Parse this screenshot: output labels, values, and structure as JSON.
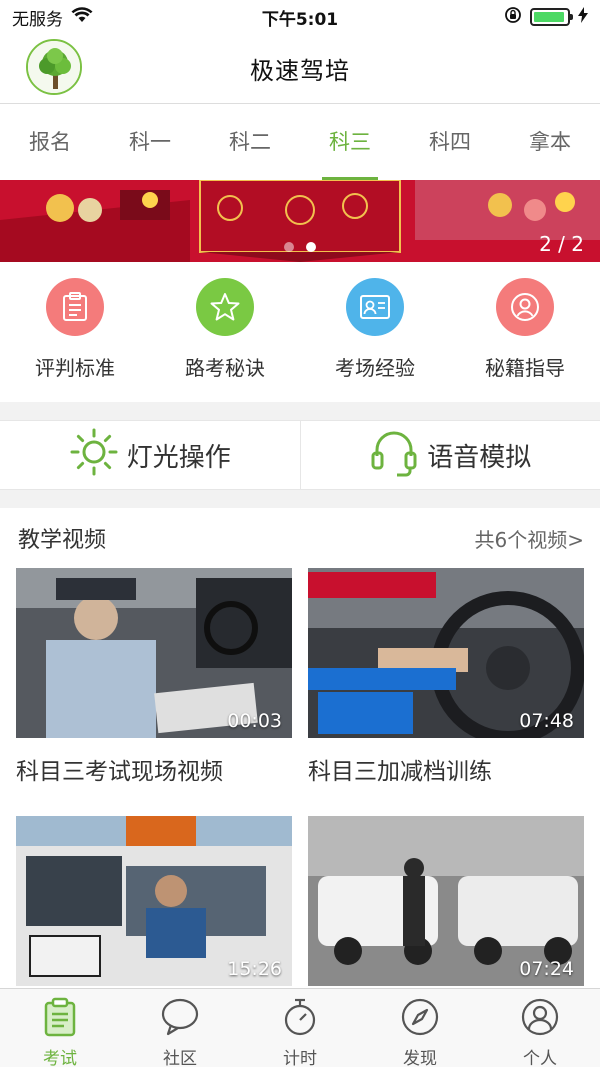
{
  "status_bar": {
    "carrier": "无服务",
    "time": "下午5:01",
    "battery_level": 0.95
  },
  "header": {
    "title": "极速驾培"
  },
  "tabs": [
    {
      "label": "报名",
      "active": false
    },
    {
      "label": "科一",
      "active": false
    },
    {
      "label": "科二",
      "active": false
    },
    {
      "label": "科三",
      "active": true
    },
    {
      "label": "科四",
      "active": false
    },
    {
      "label": "拿本",
      "active": false
    }
  ],
  "banner": {
    "counter": "2 / 2",
    "active_dot": 2,
    "dot_count": 2
  },
  "quick_actions": [
    {
      "label": "评判标准",
      "color": "#f47b7b",
      "icon": "clipboard-icon"
    },
    {
      "label": "路考秘诀",
      "color": "#7ac943",
      "icon": "star-icon"
    },
    {
      "label": "考场经验",
      "color": "#4fb4ea",
      "icon": "id-card-icon"
    },
    {
      "label": "秘籍指导",
      "color": "#f47b7b",
      "icon": "user-icon"
    }
  ],
  "features": {
    "light_label": "灯光操作",
    "voice_label": "语音模拟"
  },
  "videos": {
    "section_title": "教学视频",
    "more_label": "共6个视频>",
    "items": [
      {
        "title": "科目三考试现场视频",
        "duration": "00:03"
      },
      {
        "title": "科目三加减档训练",
        "duration": "07:48"
      },
      {
        "title": "",
        "duration": "15:26"
      },
      {
        "title": "",
        "duration": "07:24"
      }
    ]
  },
  "bottom_nav": [
    {
      "label": "考试",
      "active": true,
      "icon": "exam-icon"
    },
    {
      "label": "社区",
      "active": false,
      "icon": "chat-bubble-icon"
    },
    {
      "label": "计时",
      "active": false,
      "icon": "stopwatch-icon"
    },
    {
      "label": "发现",
      "active": false,
      "icon": "compass-icon"
    },
    {
      "label": "个人",
      "active": false,
      "icon": "person-icon"
    }
  ],
  "colors": {
    "accent": "#6db33f",
    "banner_red": "#c8102e"
  }
}
